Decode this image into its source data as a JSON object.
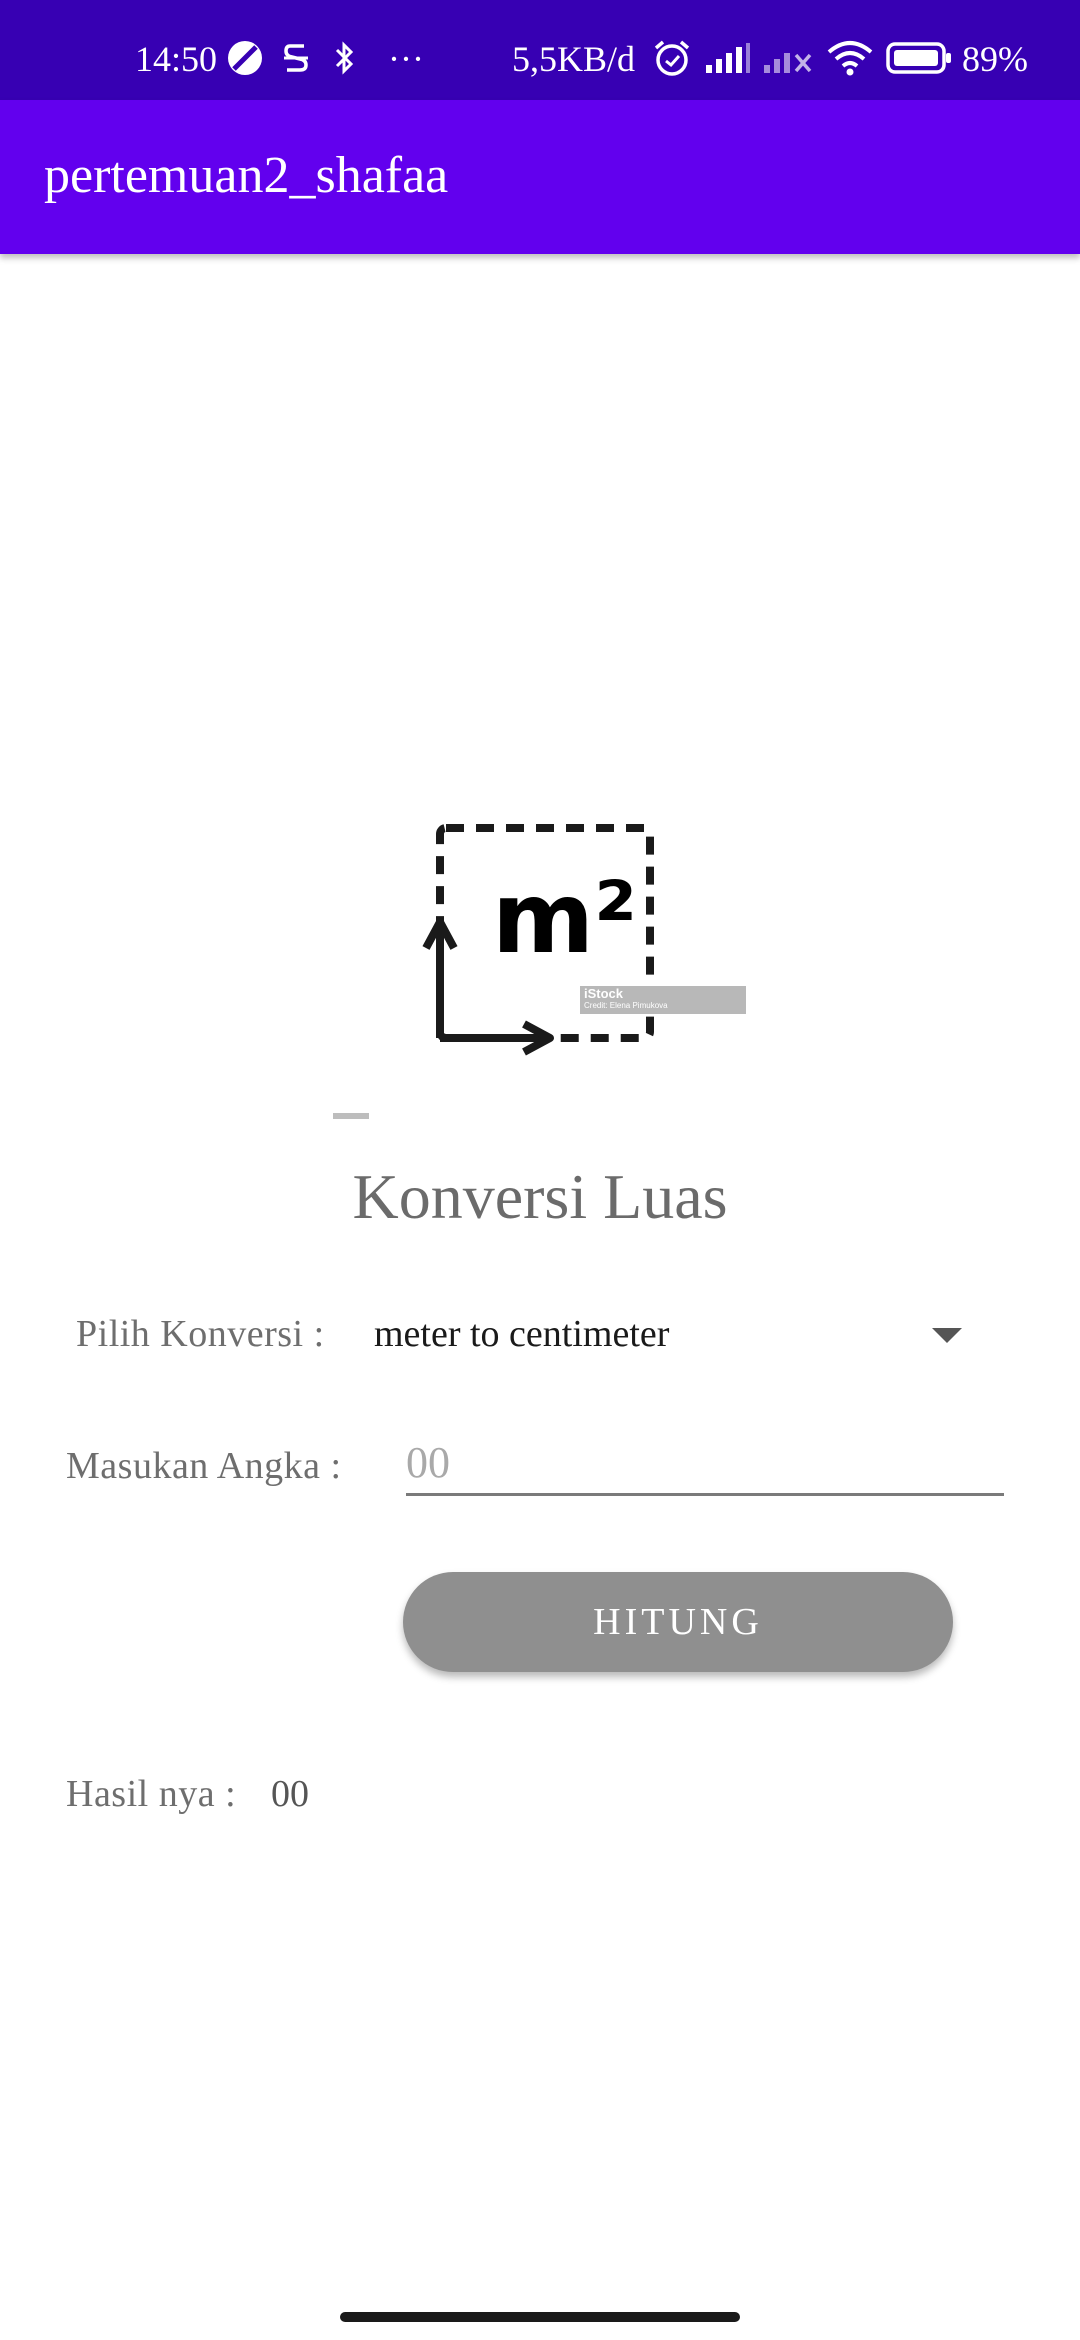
{
  "status_bar": {
    "time": "14:50",
    "network_speed": "5,5KB/d",
    "more": "···",
    "battery": "89%"
  },
  "app_bar": {
    "title": "pertemuan2_shafaa"
  },
  "image": {
    "unit_text": "m²",
    "watermark_brand": "iStock",
    "watermark_credit": "Credit: Elena Pimukova"
  },
  "main": {
    "title": "Konversi Luas",
    "conversion_label": "Pilih Konversi :",
    "conversion_selected": "meter to centimeter",
    "input_label": "Masukan Angka :",
    "input_placeholder": "00",
    "button_label": "HITUNG",
    "result_label": "Hasil nya :",
    "result_value": "00"
  },
  "colors": {
    "status_bar": "#3700b3",
    "app_bar": "#6200ee",
    "button": "#8f8f8f"
  }
}
